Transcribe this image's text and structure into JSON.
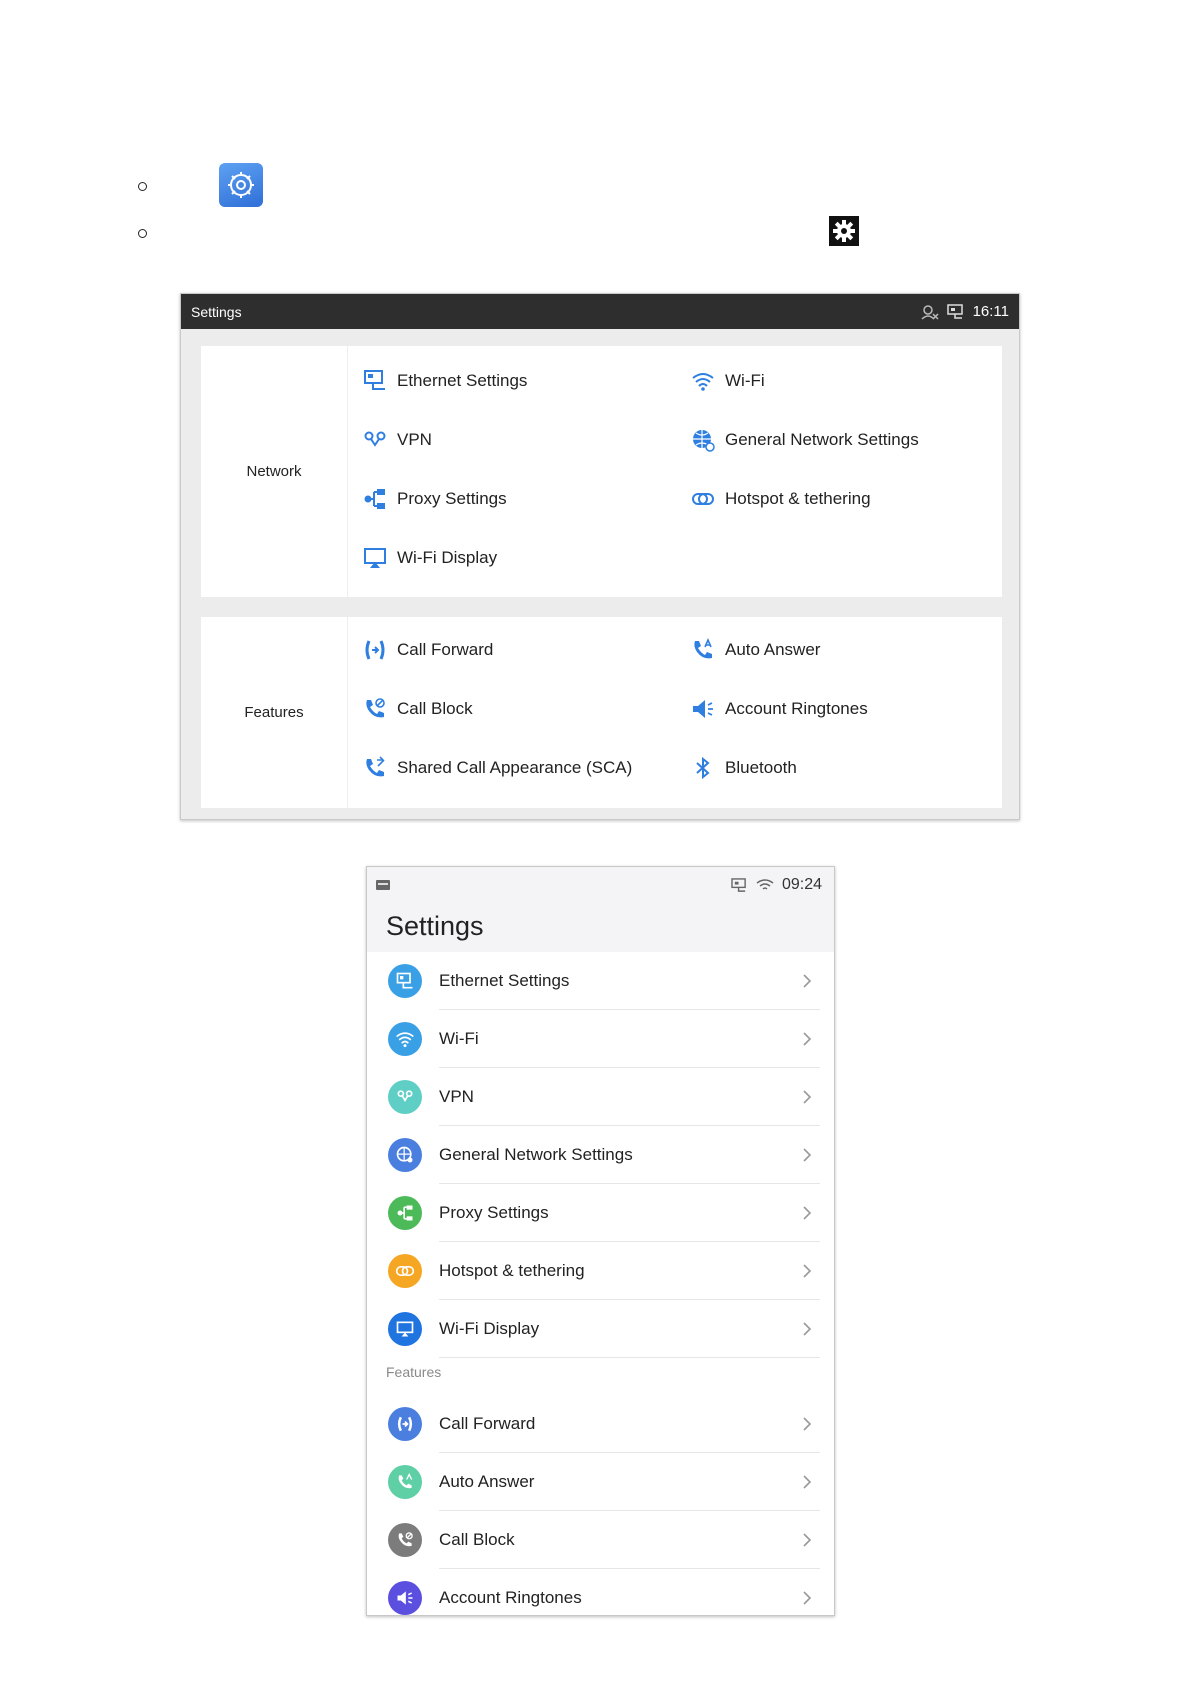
{
  "landscape": {
    "title": "Settings",
    "time": "16:11",
    "network_label": "Network",
    "features_label": "Features",
    "network_items": [
      {
        "label": "Ethernet Settings",
        "icon": "ethernet-icon"
      },
      {
        "label": "Wi-Fi",
        "icon": "wifi-icon"
      },
      {
        "label": "VPN",
        "icon": "vpn-icon"
      },
      {
        "label": "General Network Settings",
        "icon": "globe-icon"
      },
      {
        "label": "Proxy Settings",
        "icon": "proxy-icon"
      },
      {
        "label": "Hotspot & tethering",
        "icon": "hotspot-icon"
      },
      {
        "label": "Wi-Fi Display",
        "icon": "display-icon"
      }
    ],
    "feature_items": [
      {
        "label": "Call Forward",
        "icon": "call-forward-icon"
      },
      {
        "label": "Auto Answer",
        "icon": "auto-answer-icon"
      },
      {
        "label": "Call Block",
        "icon": "call-block-icon"
      },
      {
        "label": "Account Ringtones",
        "icon": "speaker-icon"
      },
      {
        "label": "Shared Call Appearance (SCA)",
        "icon": "sca-icon"
      },
      {
        "label": "Bluetooth",
        "icon": "bluetooth-icon"
      }
    ]
  },
  "portrait": {
    "time": "09:24",
    "title": "Settings",
    "features_label": "Features",
    "items": [
      {
        "label": "Ethernet Settings",
        "color": "#3aa0e6"
      },
      {
        "label": "Wi-Fi",
        "color": "#3aa0e6"
      },
      {
        "label": "VPN",
        "color": "#5fcfc6"
      },
      {
        "label": "General Network Settings",
        "color": "#4a7fe0"
      },
      {
        "label": "Proxy Settings",
        "color": "#4cba58"
      },
      {
        "label": "Hotspot & tethering",
        "color": "#f5a623"
      },
      {
        "label": "Wi-Fi Display",
        "color": "#1f74e0"
      },
      {
        "label": "Call Forward",
        "color": "#4a7fe0"
      },
      {
        "label": "Auto Answer",
        "color": "#5fcfa6"
      },
      {
        "label": "Call Block",
        "color": "#7c7c7c"
      },
      {
        "label": "Account Ringtones",
        "color": "#5b4fe0"
      }
    ]
  },
  "colors": {
    "accent_blue": "#2f7fe0",
    "topbar": "#2e2e2e"
  }
}
